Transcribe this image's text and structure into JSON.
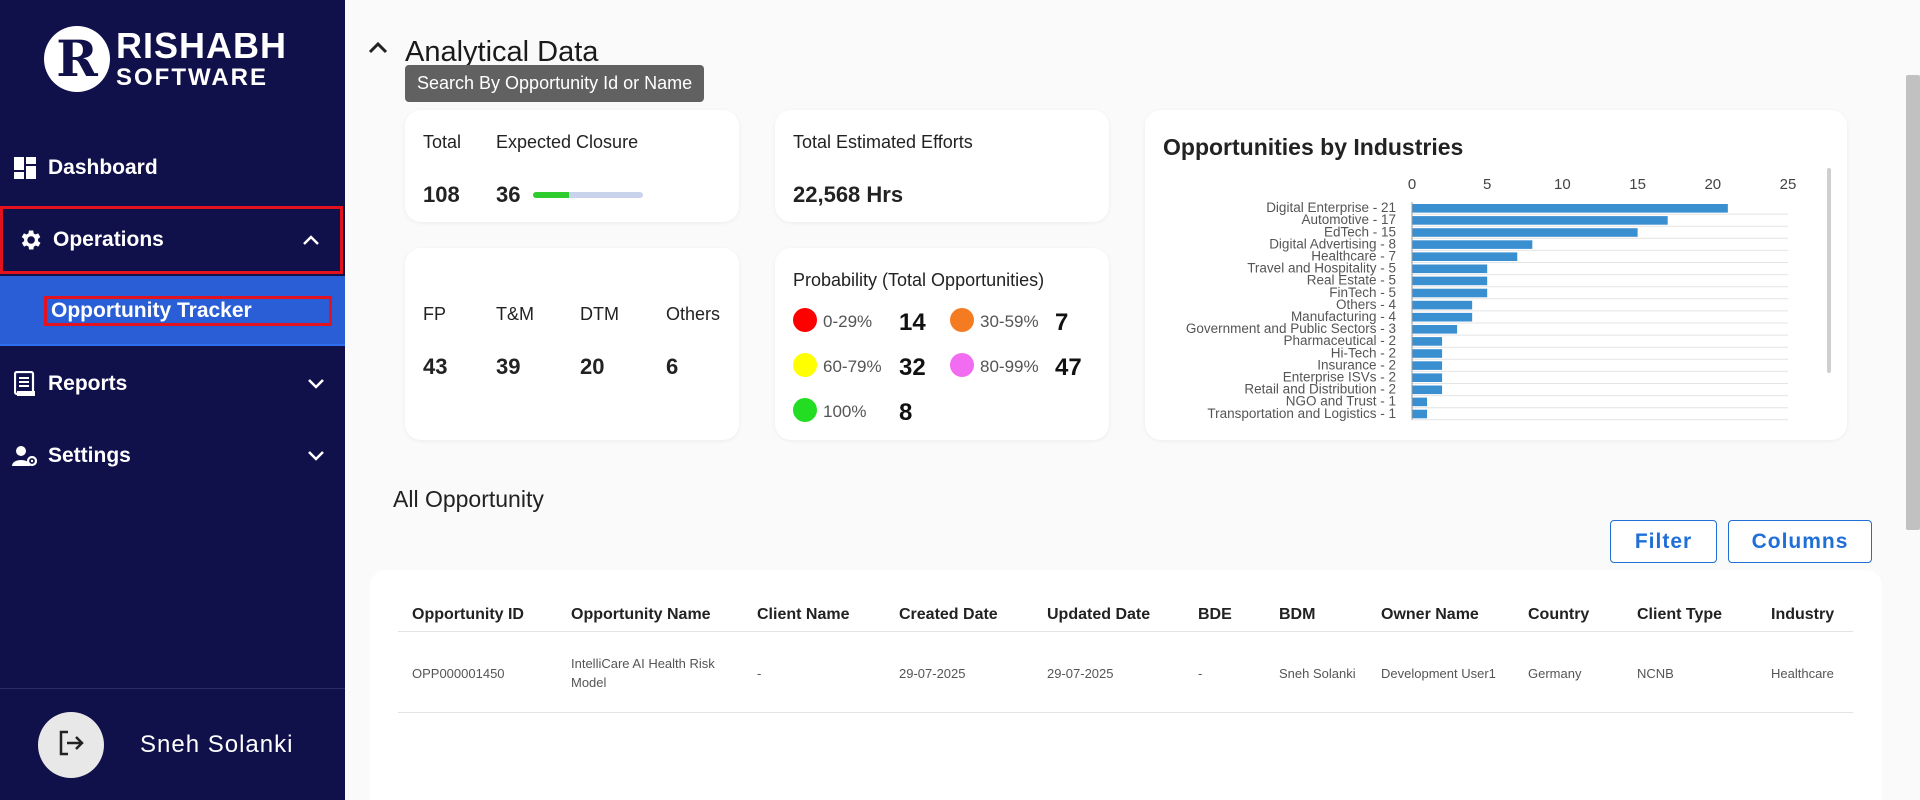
{
  "brand": {
    "logo_letter": "R",
    "line1": "RISHABH",
    "line2": "SOFTWARE"
  },
  "sidebar": {
    "items": [
      {
        "label": "Dashboard",
        "icon": "dashboard-icon"
      },
      {
        "label": "Operations",
        "icon": "gear-icon",
        "expanded": true
      },
      {
        "label": "Opportunity Tracker",
        "sub": true,
        "active": true
      },
      {
        "label": "Reports",
        "icon": "report-icon"
      },
      {
        "label": "Settings",
        "icon": "user-settings-icon"
      }
    ],
    "user": {
      "name": "Sneh Solanki",
      "icon": "logout-icon"
    }
  },
  "analytics": {
    "title": "Analytical Data",
    "tooltip": "Search By Opportunity Id or Name",
    "total": {
      "label": "Total",
      "value": "108"
    },
    "expected_closure": {
      "label": "Expected Closure",
      "value": "36",
      "progress": 0.33
    },
    "efforts": {
      "label": "Total Estimated Efforts",
      "value": "22,568 Hrs"
    },
    "types": [
      {
        "label": "FP",
        "value": "43"
      },
      {
        "label": "T&M",
        "value": "39"
      },
      {
        "label": "DTM",
        "value": "20"
      },
      {
        "label": "Others",
        "value": "6"
      }
    ],
    "probability": {
      "title": "Probability (Total Opportunities)",
      "items": [
        {
          "range": "0-29%",
          "value": "14",
          "color": "#ff0000"
        },
        {
          "range": "30-59%",
          "value": "7",
          "color": "#f47b20"
        },
        {
          "range": "60-79%",
          "value": "32",
          "color": "#ffff00"
        },
        {
          "range": "80-99%",
          "value": "47",
          "color": "#f26cf2"
        },
        {
          "range": "100%",
          "value": "8",
          "color": "#22dd22"
        }
      ]
    }
  },
  "chart_data": {
    "type": "bar",
    "orientation": "horizontal",
    "title": "Opportunities by Industries",
    "categories": [
      "Digital Enterprise - 21",
      "Automotive - 17",
      "EdTech - 15",
      "Digital Advertising - 8",
      "Healthcare - 7",
      "Travel and Hospitality - 5",
      "Real Estate - 5",
      "FinTech - 5",
      "Others - 4",
      "Manufacturing - 4",
      "Government and Public Sectors - 3",
      "Pharmaceutical - 2",
      "Hi-Tech - 2",
      "Insurance - 2",
      "Enterprise ISVs - 2",
      "Retail and Distribution - 2",
      "NGO and Trust - 1",
      "Transportation and Logistics - 1"
    ],
    "values": [
      21,
      17,
      15,
      8,
      7,
      5,
      5,
      5,
      4,
      4,
      3,
      2,
      2,
      2,
      2,
      2,
      1,
      1
    ],
    "xlim": [
      0,
      25
    ],
    "xticks": [
      0,
      5,
      10,
      15,
      20,
      25
    ],
    "bar_color": "#3a8fd1",
    "grid": true
  },
  "opportunities": {
    "title": "All Opportunity",
    "filter_label": "Filter",
    "columns_label": "Columns",
    "headers": [
      "Opportunity ID",
      "Opportunity Name",
      "Client Name",
      "Created Date",
      "Updated Date",
      "BDE",
      "BDM",
      "Owner Name",
      "Country",
      "Client Type",
      "Industry"
    ],
    "rows": [
      [
        "OPP000001450",
        "IntelliCare AI Health Risk Model",
        "-",
        "29-07-2025",
        "29-07-2025",
        "-",
        "Sneh Solanki",
        "Development User1",
        "Germany",
        "NCNB",
        "Healthcare"
      ]
    ]
  }
}
